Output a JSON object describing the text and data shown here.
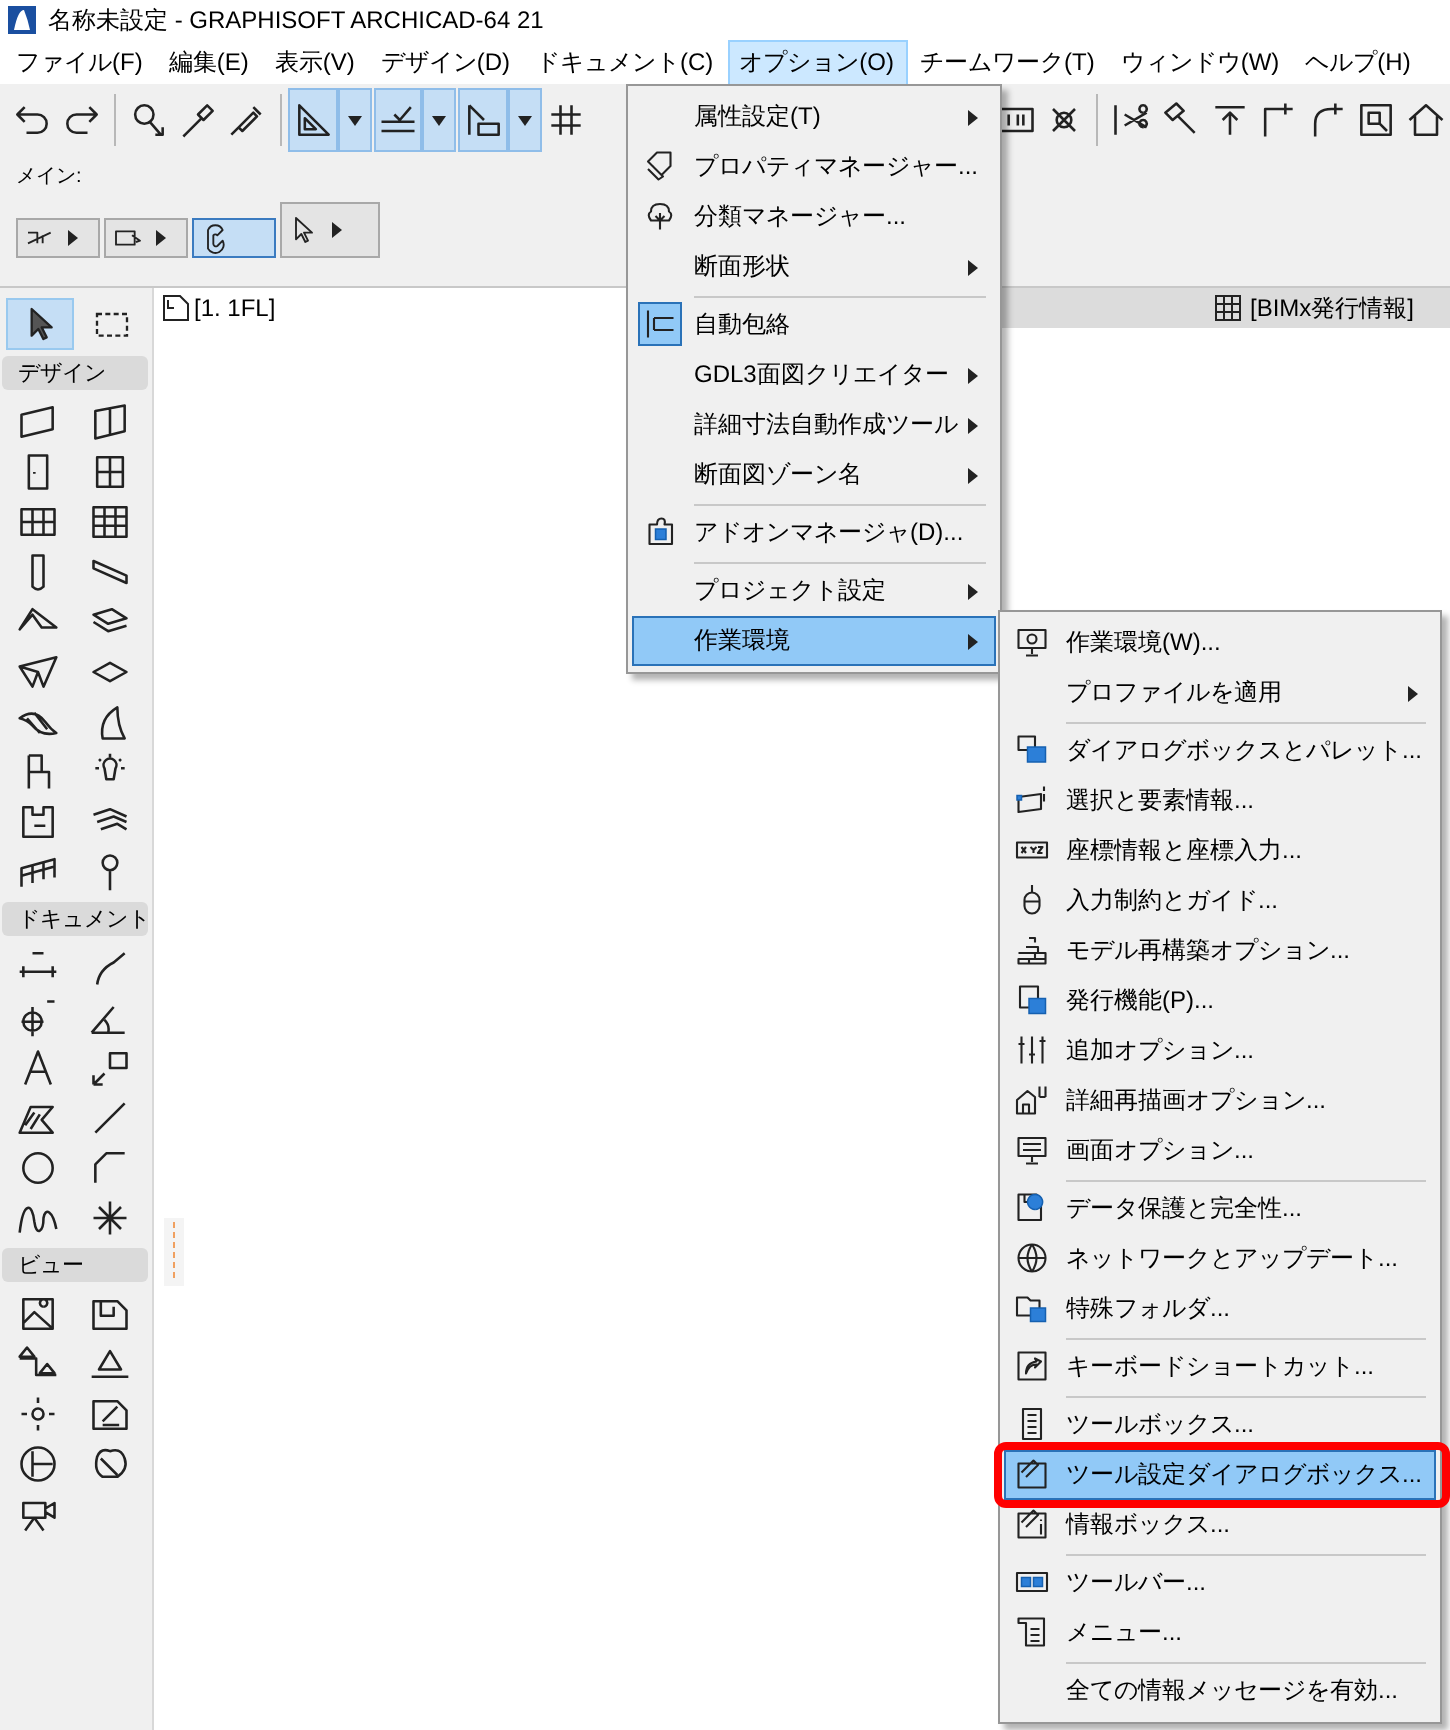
{
  "window": {
    "title": "名称未設定 - GRAPHISOFT ARCHICAD-64 21"
  },
  "menu_bar": [
    {
      "label": "ファイル(F)",
      "selected": false
    },
    {
      "label": "編集(E)",
      "selected": false
    },
    {
      "label": "表示(V)",
      "selected": false
    },
    {
      "label": "デザイン(D)",
      "selected": false
    },
    {
      "label": "ドキュメント(C)",
      "selected": false
    },
    {
      "label": "オプション(O)",
      "selected": true
    },
    {
      "label": "チームワーク(T)",
      "selected": false
    },
    {
      "label": "ウィンドウ(W)",
      "selected": false
    },
    {
      "label": "ヘルプ(H)",
      "selected": false
    }
  ],
  "toolbar": [
    {
      "selected": false
    },
    {
      "selected": false
    },
    {
      "selected": false
    },
    {
      "selected": false
    },
    {
      "selected": false
    },
    {
      "selected": true
    },
    {
      "selected": true
    },
    {
      "selected": true
    },
    {
      "selected": false
    },
    {
      "selected": false
    },
    {
      "selected": false
    },
    {
      "selected": false
    },
    {
      "selected": false
    },
    {
      "selected": false
    },
    {
      "selected": false
    },
    {
      "selected": false
    },
    {
      "selected": false
    },
    {
      "selected": false
    }
  ],
  "info_box": {
    "label": "メイン:",
    "buttons": [
      {
        "selected": false
      },
      {
        "selected": false
      },
      {
        "selected": true
      },
      {
        "selected": false
      }
    ]
  },
  "view_tab": {
    "label": "[1. 1FL]"
  },
  "bimx_tab": {
    "label": "[BIMx発行情報]"
  },
  "toolbox": {
    "selection_tools": [
      {
        "selected": true
      },
      {
        "selected": false
      }
    ],
    "sections": [
      {
        "title": "デザイン"
      },
      {
        "title": "ドキュメント"
      },
      {
        "title": "ビュー"
      }
    ]
  },
  "options_menu": [
    {
      "label": "属性設定(T)",
      "submenu": true,
      "checked": false,
      "selected": false,
      "separator_before": false
    },
    {
      "label": "プロパティマネージャー...",
      "submenu": false,
      "checked": false,
      "selected": false,
      "separator_before": false
    },
    {
      "label": "分類マネージャー...",
      "submenu": false,
      "checked": false,
      "selected": false,
      "separator_before": false
    },
    {
      "label": "断面形状",
      "submenu": true,
      "checked": false,
      "selected": false,
      "separator_before": false
    },
    {
      "label": "自動包絡",
      "submenu": false,
      "checked": true,
      "selected": false,
      "separator_before": true
    },
    {
      "label": "GDL3面図クリエイター",
      "submenu": true,
      "checked": false,
      "selected": false,
      "separator_before": false
    },
    {
      "label": "詳細寸法自動作成ツール",
      "submenu": true,
      "checked": false,
      "selected": false,
      "separator_before": false
    },
    {
      "label": "断面図ゾーン名",
      "submenu": true,
      "checked": false,
      "selected": false,
      "separator_before": false
    },
    {
      "label": "アドオンマネージャ(D)...",
      "submenu": false,
      "checked": false,
      "selected": false,
      "separator_before": true
    },
    {
      "label": "プロジェクト設定",
      "submenu": true,
      "checked": false,
      "selected": false,
      "separator_before": true
    },
    {
      "label": "作業環境",
      "submenu": true,
      "checked": false,
      "selected": true,
      "separator_before": false
    }
  ],
  "work_environment_menu": [
    {
      "label": "作業環境(W)...",
      "submenu": false,
      "selected": false,
      "outlined": false,
      "separator_before": false
    },
    {
      "label": "プロファイルを適用",
      "submenu": true,
      "selected": false,
      "outlined": false,
      "separator_before": false
    },
    {
      "label": "ダイアログボックスとパレット...",
      "submenu": false,
      "selected": false,
      "outlined": false,
      "separator_before": true
    },
    {
      "label": "選択と要素情報...",
      "submenu": false,
      "selected": false,
      "outlined": false,
      "separator_before": false
    },
    {
      "label": "座標情報と座標入力...",
      "submenu": false,
      "selected": false,
      "outlined": false,
      "separator_before": false
    },
    {
      "label": "入力制約とガイド...",
      "submenu": false,
      "selected": false,
      "outlined": false,
      "separator_before": false
    },
    {
      "label": "モデル再構築オプション...",
      "submenu": false,
      "selected": false,
      "outlined": false,
      "separator_before": false
    },
    {
      "label": "発行機能(P)...",
      "submenu": false,
      "selected": false,
      "outlined": false,
      "separator_before": false
    },
    {
      "label": "追加オプション...",
      "submenu": false,
      "selected": false,
      "outlined": false,
      "separator_before": false
    },
    {
      "label": "詳細再描画オプション...",
      "submenu": false,
      "selected": false,
      "outlined": false,
      "separator_before": false
    },
    {
      "label": "画面オプション...",
      "submenu": false,
      "selected": false,
      "outlined": false,
      "separator_before": false
    },
    {
      "label": "データ保護と完全性...",
      "submenu": false,
      "selected": false,
      "outlined": false,
      "separator_before": true
    },
    {
      "label": "ネットワークとアップデート...",
      "submenu": false,
      "selected": false,
      "outlined": false,
      "separator_before": false
    },
    {
      "label": "特殊フォルダ...",
      "submenu": false,
      "selected": false,
      "outlined": false,
      "separator_before": false
    },
    {
      "label": "キーボードショートカット...",
      "submenu": false,
      "selected": false,
      "outlined": false,
      "separator_before": true
    },
    {
      "label": "ツールボックス...",
      "submenu": false,
      "selected": false,
      "outlined": false,
      "separator_before": true
    },
    {
      "label": "ツール設定ダイアログボックス...",
      "submenu": false,
      "selected": true,
      "outlined": true,
      "separator_before": false
    },
    {
      "label": "情報ボックス...",
      "submenu": false,
      "selected": false,
      "outlined": false,
      "separator_before": false
    },
    {
      "label": "ツールバー...",
      "submenu": false,
      "selected": false,
      "outlined": false,
      "separator_before": true
    },
    {
      "label": "メニュー...",
      "submenu": false,
      "selected": false,
      "outlined": false,
      "separator_before": false
    },
    {
      "label": "全ての情報メッセージを有効...",
      "submenu": false,
      "selected": false,
      "outlined": false,
      "separator_before": true
    }
  ]
}
